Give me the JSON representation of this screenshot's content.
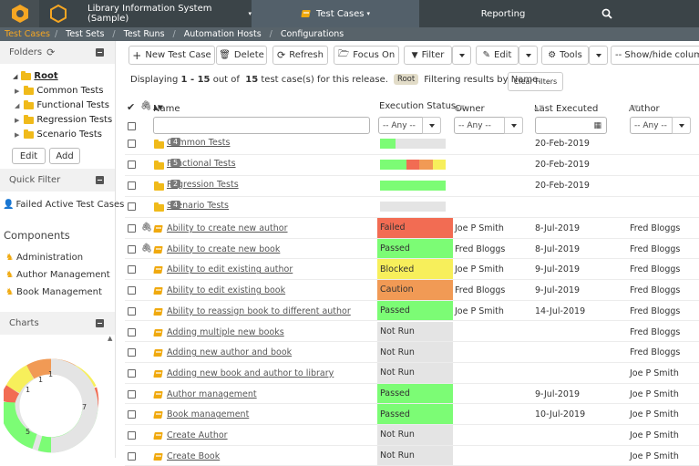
{
  "topbar": {
    "project": "Library Information System (Sample)",
    "tab_test_cases": "Test Cases",
    "tab_reporting": "Reporting"
  },
  "subnav": [
    "Test Cases",
    "Test Sets",
    "Test Runs",
    "Automation Hosts",
    "Configurations"
  ],
  "sidebar": {
    "folders_title": "Folders",
    "tree": [
      "Root",
      "Common Tests",
      "Functional Tests",
      "Regression Tests",
      "Scenario Tests"
    ],
    "edit_label": "Edit",
    "add_label": "Add",
    "quick_filter_title": "Quick Filter",
    "quick_filter_item": "Failed Active Test Cases",
    "components_title": "Components",
    "components": [
      "Administration",
      "Author Management",
      "Book Management"
    ],
    "charts_title": "Charts",
    "chart_labels": [
      "1",
      "1",
      "1",
      "5",
      "7"
    ]
  },
  "toolbar": {
    "new": "New Test Case",
    "delete": "Delete",
    "refresh": "Refresh",
    "focus": "Focus On",
    "filter": "Filter",
    "edit": "Edit",
    "tools": "Tools",
    "showhide": "-- Show/hide columns --"
  },
  "info": {
    "prefix": "Displaying ",
    "range": "1 - 15",
    "mid": " out of ",
    "total": "15",
    "suffix": " test case(s) for this release.",
    "root": "Root",
    "filtering": "Filtering results by Name.",
    "clear": "Clear Filters"
  },
  "columns": {
    "name": "Name",
    "status": "Execution Status",
    "owner": "Owner",
    "last": "Last Executed",
    "author": "Author"
  },
  "filters": {
    "any": "-- Any --"
  },
  "colors": {
    "passed": "#7cfc75",
    "failed": "#f26c53",
    "blocked": "#f7ef5b",
    "caution": "#f19a55",
    "notrun": "#e4e4e4"
  },
  "folders": [
    {
      "name": "Common Tests",
      "count": "4",
      "date": "20-Feb-2019",
      "bar": [
        [
          "passed",
          0.23
        ],
        [
          "notrun",
          0.77
        ]
      ]
    },
    {
      "name": "Functional Tests",
      "count": "5",
      "date": "20-Feb-2019",
      "bar": [
        [
          "passed",
          0.4
        ],
        [
          "failed",
          0.2
        ],
        [
          "caution",
          0.2
        ],
        [
          "blocked",
          0.2
        ]
      ]
    },
    {
      "name": "Regression Tests",
      "count": "2",
      "date": "20-Feb-2019",
      "bar": [
        [
          "passed",
          1.0
        ]
      ]
    },
    {
      "name": "Scenario Tests",
      "count": "4",
      "date": "",
      "bar": [
        [
          "notrun",
          1.0
        ]
      ]
    }
  ],
  "cases": [
    {
      "name": "Ability to create new author",
      "status": "Failed",
      "color": "failed",
      "owner": "Joe P Smith",
      "date": "8-Jul-2019",
      "author": "Fred Bloggs",
      "attach": true
    },
    {
      "name": "Ability to create new book",
      "status": "Passed",
      "color": "passed",
      "owner": "Fred Bloggs",
      "date": "8-Jul-2019",
      "author": "Fred Bloggs",
      "attach": true
    },
    {
      "name": "Ability to edit existing author",
      "status": "Blocked",
      "color": "blocked",
      "owner": "Joe P Smith",
      "date": "9-Jul-2019",
      "author": "Fred Bloggs",
      "attach": false
    },
    {
      "name": "Ability to edit existing book",
      "status": "Caution",
      "color": "caution",
      "owner": "Fred Bloggs",
      "date": "9-Jul-2019",
      "author": "Fred Bloggs",
      "attach": false
    },
    {
      "name": "Ability to reassign book to different author",
      "status": "Passed",
      "color": "passed",
      "owner": "Joe P Smith",
      "date": "14-Jul-2019",
      "author": "Fred Bloggs",
      "attach": false
    },
    {
      "name": "Adding multiple new books",
      "status": "Not Run",
      "color": "notrun",
      "owner": "",
      "date": "",
      "author": "Fred Bloggs",
      "attach": false
    },
    {
      "name": "Adding new author and book",
      "status": "Not Run",
      "color": "notrun",
      "owner": "",
      "date": "",
      "author": "Fred Bloggs",
      "attach": false
    },
    {
      "name": "Adding new book and author to library",
      "status": "Not Run",
      "color": "notrun",
      "owner": "",
      "date": "",
      "author": "Joe P Smith",
      "attach": false
    },
    {
      "name": "Author management",
      "status": "Passed",
      "color": "passed",
      "owner": "",
      "date": "9-Jul-2019",
      "author": "Joe P Smith",
      "attach": false
    },
    {
      "name": "Book management",
      "status": "Passed",
      "color": "passed",
      "owner": "",
      "date": "10-Jul-2019",
      "author": "Joe P Smith",
      "attach": false
    },
    {
      "name": "Create Author",
      "status": "Not Run",
      "color": "notrun",
      "owner": "",
      "date": "",
      "author": "Joe P Smith",
      "attach": false
    },
    {
      "name": "Create Book",
      "status": "Not Run",
      "color": "notrun",
      "owner": "",
      "date": "",
      "author": "Joe P Smith",
      "attach": false
    }
  ]
}
